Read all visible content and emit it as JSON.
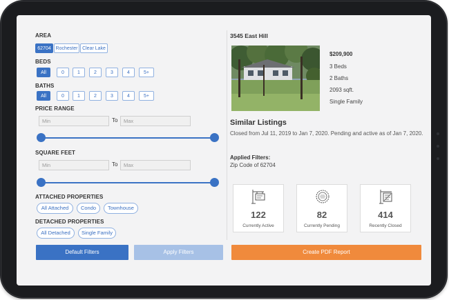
{
  "filters": {
    "area": {
      "label": "AREA",
      "options": [
        "62704",
        "Rochester",
        "Clear Lake"
      ],
      "selected": "62704"
    },
    "beds": {
      "label": "BEDS",
      "options": [
        "All",
        "0",
        "1",
        "2",
        "3",
        "4",
        "5+"
      ],
      "selected": "All"
    },
    "baths": {
      "label": "BATHS",
      "options": [
        "All",
        "0",
        "1",
        "2",
        "3",
        "4",
        "5+"
      ],
      "selected": "All"
    },
    "price_range": {
      "label": "PRICE RANGE",
      "min_placeholder": "Min",
      "to_label": "To",
      "max_placeholder": "Max",
      "slider_low": 0,
      "slider_high": 1
    },
    "square_feet": {
      "label": "SQUARE FEET",
      "min_placeholder": "Min",
      "to_label": "To",
      "max_placeholder": "Max",
      "slider_low": 0,
      "slider_high": 1
    },
    "attached": {
      "label": "ATTACHED PROPERTIES",
      "options": [
        "All Attached",
        "Condo",
        "Townhouse"
      ]
    },
    "detached": {
      "label": "DETACHED PROPERTIES",
      "options": [
        "All Detached",
        "Single Family"
      ]
    }
  },
  "property": {
    "address": "3545 East Hill",
    "price": "$209,900",
    "beds": "3 Beds",
    "baths": "2 Baths",
    "sqft": "2093 sqft.",
    "type": "Single Family"
  },
  "similar": {
    "title": "Similar Listings",
    "description": "Closed from Jul 11, 2019 to Jan 7, 2020. Pending and active as of Jan 7, 2020.",
    "applied_title": "Applied Filters:",
    "applied_value": "Zip Code of 62704"
  },
  "stats": [
    {
      "value": "122",
      "caption": "Currently Active",
      "icon": "for-sale-sign-icon"
    },
    {
      "value": "82",
      "caption": "Currently Pending",
      "icon": "contract-seal-icon"
    },
    {
      "value": "414",
      "caption": "Recently Closed",
      "icon": "sold-sign-icon"
    }
  ],
  "buttons": {
    "default": "Default Filters",
    "apply": "Apply Filters",
    "report": "Create PDF Report"
  },
  "colors": {
    "accent": "#3a72c4",
    "accent_light": "#a7c1e6",
    "report": "#f08a3c",
    "frame": "#1b1c1f"
  }
}
